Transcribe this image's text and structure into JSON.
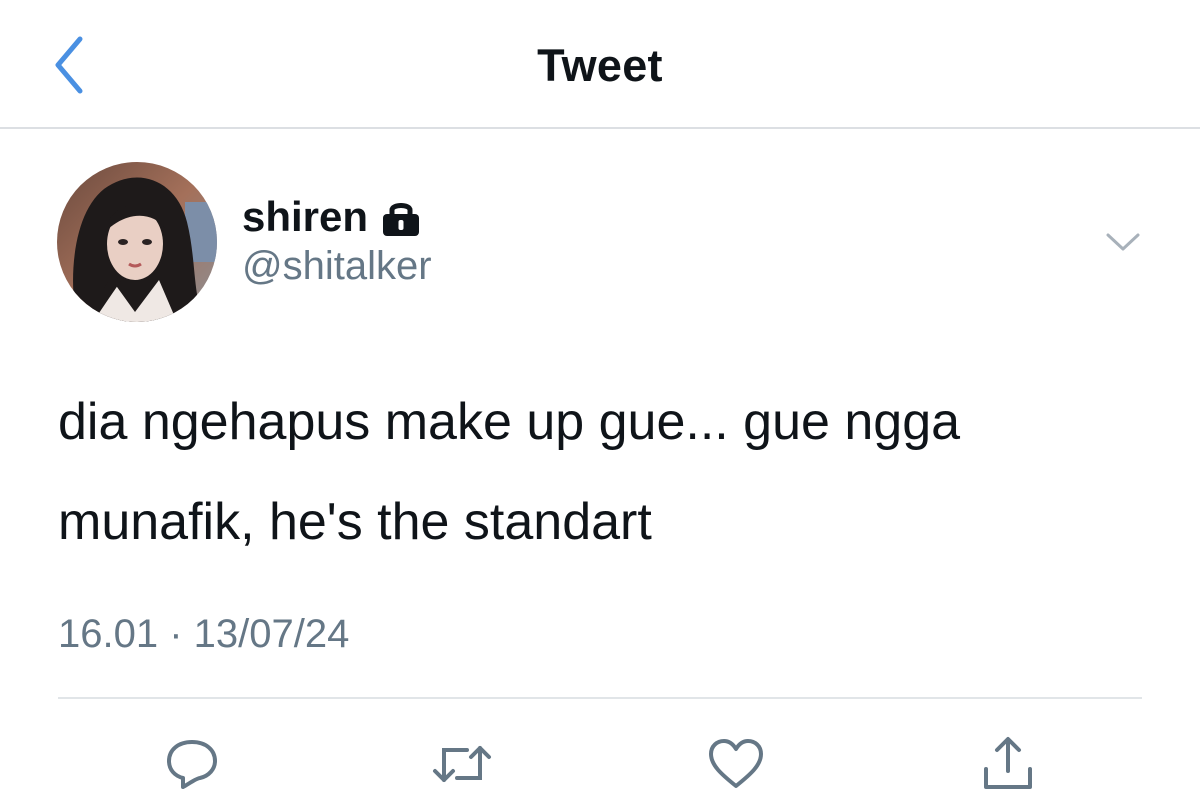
{
  "header": {
    "title": "Tweet",
    "back_icon": "chevron-left-icon",
    "accent_color": "#4a90e2"
  },
  "tweet": {
    "display_name": "shiren",
    "protected_icon": "lock-icon",
    "handle": "@shitalker",
    "text": "dia ngehapus make up gue... gue ngga munafik, he's the standart",
    "timestamp": "16.01 · 13/07/24",
    "more_icon": "chevron-down-icon"
  },
  "actions": [
    {
      "name": "reply",
      "icon": "comment-icon"
    },
    {
      "name": "retweet",
      "icon": "retweet-icon"
    },
    {
      "name": "like",
      "icon": "heart-icon"
    },
    {
      "name": "share",
      "icon": "share-icon"
    }
  ],
  "colors": {
    "text_primary": "#0f1419",
    "text_secondary": "#657786",
    "divider": "#e1e5e8"
  }
}
